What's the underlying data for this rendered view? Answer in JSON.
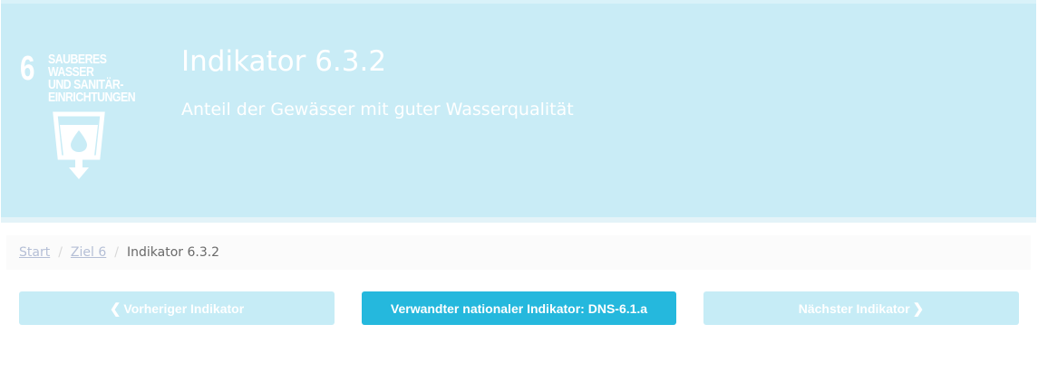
{
  "goal": {
    "number": "6",
    "title_lines": [
      "SAUBERES WASSER",
      "UND SANITÄR-",
      "EINRICHTUNGEN"
    ],
    "icon": "water-drop-glass-icon"
  },
  "header": {
    "title": "Indikator 6.3.2",
    "subtitle": "Anteil der Gewässer mit guter Wasserqualität"
  },
  "breadcrumb": {
    "items": [
      {
        "label": "Start"
      },
      {
        "label": "Ziel 6"
      },
      {
        "label": "Indikator 6.3.2"
      }
    ],
    "separator": "/"
  },
  "nav": {
    "prev_label": "Vorheriger Indikator",
    "related_label": "Verwandter nationaler Indikator: DNS-6.1.a",
    "next_label": "Nächster Indikator",
    "prev_icon": "chevron-left-icon",
    "next_icon": "chevron-right-icon"
  },
  "colors": {
    "banner": "#c9ecf6",
    "primary_button": "#25b8dd",
    "disabled_button": "#c6ecf6"
  }
}
